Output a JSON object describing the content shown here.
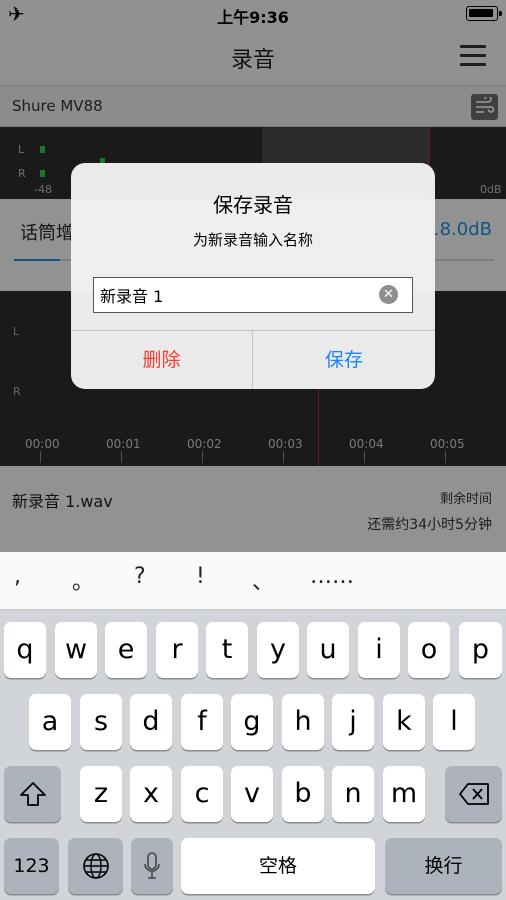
{
  "status_bar": {
    "time": "上午9:36",
    "airplane_icon": "airplane-icon",
    "battery_icon": "battery-icon"
  },
  "nav": {
    "title": "录音",
    "menu_icon": "hamburger-menu-icon"
  },
  "device": {
    "name": "Shure MV88",
    "wind_icon": "wind-filter-icon"
  },
  "meter": {
    "left_channel": "L",
    "right_channel": "R",
    "min_label": "-48",
    "max_label": "0dB"
  },
  "gain": {
    "label": "话筒增",
    "value": "18.0dB",
    "accent": "#1a8fd6"
  },
  "waveform": {
    "left_channel": "L",
    "right_channel": "R",
    "ticks": [
      "00:00",
      "00:01",
      "00:02",
      "00:03",
      "00:04",
      "00:05"
    ]
  },
  "file": {
    "name": "新录音 1.wav",
    "remaining_label": "剩余时间",
    "remaining_value": "还需约34小时5分钟"
  },
  "dialog": {
    "title": "保存录音",
    "message": "为新录音输入名称",
    "input_value": "新录音 1",
    "delete_label": "删除",
    "save_label": "保存",
    "delete_color": "#ff3b30",
    "save_color": "#1a82fb"
  },
  "candidates": [
    ",",
    "。",
    "?",
    "!",
    "、",
    "……"
  ],
  "keyboard": {
    "row1": [
      "q",
      "w",
      "e",
      "r",
      "t",
      "y",
      "u",
      "i",
      "o",
      "p"
    ],
    "row2": [
      "a",
      "s",
      "d",
      "f",
      "g",
      "h",
      "j",
      "k",
      "l"
    ],
    "row3": [
      "z",
      "x",
      "c",
      "v",
      "b",
      "n",
      "m"
    ],
    "numbers_key": "123",
    "space_key": "空格",
    "return_key": "换行",
    "shift_icon": "shift-icon",
    "delete_icon": "backspace-icon",
    "globe_icon": "globe-icon",
    "mic_icon": "microphone-icon"
  }
}
